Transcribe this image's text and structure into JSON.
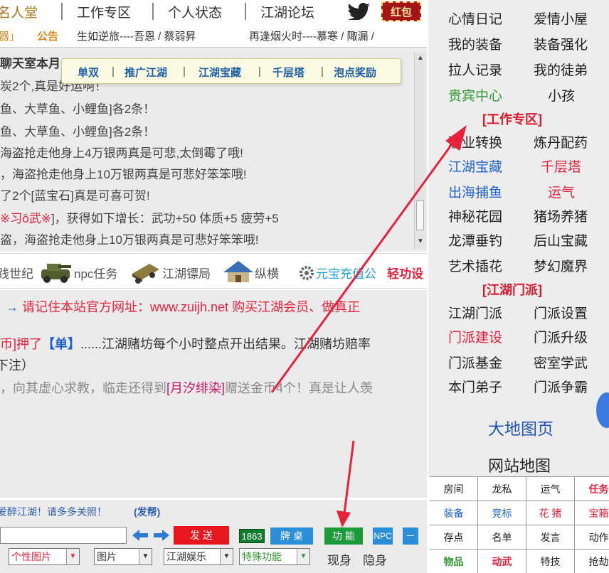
{
  "topnav": {
    "items": [
      "名人堂",
      "工作专区",
      "个人状态",
      "江湖论坛"
    ],
    "hongbao": "红包"
  },
  "announce": {
    "prefix": "器」",
    "label": "公告",
    "text1": "生如逆旅----吾恩 / 蔡弱昇",
    "text2": "再逢烟火时----慕寒 / 陬漏 /"
  },
  "chatlog": {
    "lines": [
      "聊天室本月",
      "炭2个,真是好运啊！",
      "鱼、大草鱼、小鲤鱼]各2条！",
      "鱼、大草鱼、小鲤鱼]各2条！",
      "海盗抢走他身上4万银两真是可悲,太倒霉了哦!",
      "，海盗抢走他身上10万银两真是可悲好笨笨哦!",
      "了2个[蓝宝石]真是可喜可贺!",
      "※习ô武※]，获得如下增长：武功+50 体质+5 疲劳+5",
      "盗，海盗抢走他身上10万银两真是可悲好笨笨哦!"
    ],
    "highlight": "※习ô武※"
  },
  "popup": {
    "items": [
      "单双",
      "推广江湖",
      "江湖宝藏",
      "千层塔",
      "泡点奖励"
    ]
  },
  "iconstrip": {
    "items": [
      "践世纪",
      "npc任务",
      "江湖镖局",
      "纵横",
      "元宝充值公",
      "轻功设"
    ]
  },
  "messages": {
    "line1_arrow": "→",
    "line1": "请记住本站官方网址：www.zuijh.net 购买江湖会员、做真正",
    "line2_prefix": "币]押了",
    "line2_bet": "【单】",
    "line2_rest": "......江湖赌坊每个小时整点开出结果。江湖赌坊赔率",
    "line3": "下注）",
    "line4_a": "，向其虚心求教，临走还得到",
    "line4_item": "[月汐绯染]",
    "line4_b": "赠送金币4个！真是让人羡"
  },
  "welcome": {
    "text": "爱醉江湖！请多多关照！",
    "send": "(发帮)"
  },
  "controls": {
    "send": "发 送",
    "count": "1863",
    "bottle": "牌 桌",
    "func": "功 能",
    "npc": "NPC",
    "minus": "－",
    "selects": [
      "个性图片",
      "图片",
      "江湖娱乐",
      "特殊功能"
    ],
    "show": "现身",
    "hide": "隐身"
  },
  "sidebar": {
    "rows1": [
      [
        "心情日记",
        "爱情小屋"
      ],
      [
        "我的装备",
        "装备强化"
      ],
      [
        "拉人记录",
        "我的徒弟"
      ],
      [
        "贵宾中心",
        "小孩"
      ]
    ],
    "header_work": "[工作专区]",
    "rows2": [
      [
        "职业转换",
        "炼丹配药"
      ],
      [
        "江湖宝藏",
        "千层塔"
      ],
      [
        "出海捕鱼",
        "运气"
      ],
      [
        "神秘花园",
        "猪场养猪"
      ],
      [
        "龙潭垂钓",
        "后山宝藏"
      ],
      [
        "艺术插花",
        "梦幻魔界"
      ]
    ],
    "header_sect": "[江湖门派]",
    "rows3": [
      [
        "江湖门派",
        "门派设置"
      ],
      [
        "门派建设",
        "门派升级"
      ],
      [
        "门派基金",
        "密室学武"
      ],
      [
        "本门弟子",
        "门派争霸"
      ]
    ],
    "map": "大地图页",
    "sitemap": "网站地图",
    "colors": {
      "link_red": "#e8213a",
      "link_blue": "#1e62d0",
      "link_green": "#2f9a2f"
    }
  },
  "grid": {
    "rows": [
      [
        "房间",
        "龙私",
        "运气",
        "任务"
      ],
      [
        "装备",
        "竞标",
        "花 猪",
        "宝箱"
      ],
      [
        "存点",
        "名单",
        "发言",
        "动作"
      ],
      [
        "物品",
        "动武",
        "特技",
        "抢劫"
      ]
    ]
  }
}
